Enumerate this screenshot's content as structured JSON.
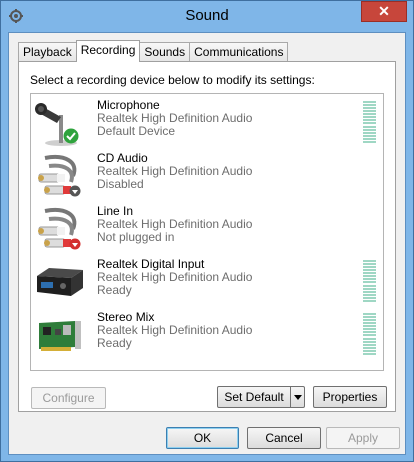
{
  "window": {
    "title": "Sound",
    "close_label": "✕"
  },
  "tabs": [
    {
      "label": "Playback"
    },
    {
      "label": "Recording"
    },
    {
      "label": "Sounds"
    },
    {
      "label": "Communications"
    }
  ],
  "instruction": "Select a recording device below to modify its settings:",
  "devices": [
    {
      "name": "Microphone",
      "driver": "Realtek High Definition Audio",
      "status": "Default Device",
      "icon": "microphone-icon"
    },
    {
      "name": "CD Audio",
      "driver": "Realtek High Definition Audio",
      "status": "Disabled",
      "icon": "rca-cable-icon"
    },
    {
      "name": "Line In",
      "driver": "Realtek High Definition Audio",
      "status": "Not plugged in",
      "icon": "rca-cable-icon"
    },
    {
      "name": "Realtek Digital Input",
      "driver": "Realtek High Definition Audio",
      "status": "Ready",
      "icon": "digital-receiver-icon"
    },
    {
      "name": "Stereo Mix",
      "driver": "Realtek High Definition Audio",
      "status": "Ready",
      "icon": "sound-card-icon"
    }
  ],
  "buttons": {
    "configure": "Configure",
    "set_default": "Set Default",
    "properties": "Properties",
    "ok": "OK",
    "cancel": "Cancel",
    "apply": "Apply"
  },
  "colors": {
    "title_bar": "#7fb6e8",
    "close_button": "#c7463b",
    "level_meter": "#9fd7c4",
    "secondary_text": "#6d6d6d"
  }
}
